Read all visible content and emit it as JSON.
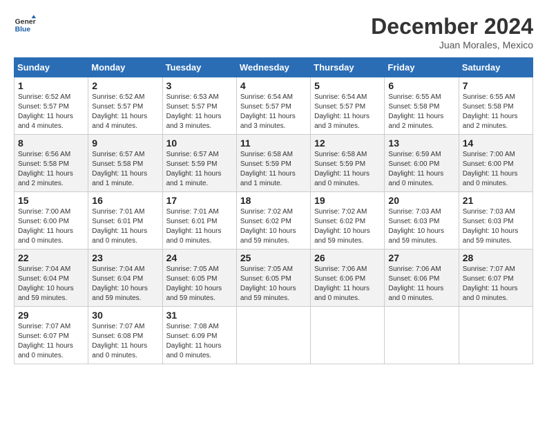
{
  "header": {
    "logo_text_general": "General",
    "logo_text_blue": "Blue",
    "main_title": "December 2024",
    "subtitle": "Juan Morales, Mexico"
  },
  "calendar": {
    "days_of_week": [
      "Sunday",
      "Monday",
      "Tuesday",
      "Wednesday",
      "Thursday",
      "Friday",
      "Saturday"
    ],
    "weeks": [
      [
        {
          "day": "1",
          "info": "Sunrise: 6:52 AM\nSunset: 5:57 PM\nDaylight: 11 hours and 4 minutes."
        },
        {
          "day": "2",
          "info": "Sunrise: 6:52 AM\nSunset: 5:57 PM\nDaylight: 11 hours and 4 minutes."
        },
        {
          "day": "3",
          "info": "Sunrise: 6:53 AM\nSunset: 5:57 PM\nDaylight: 11 hours and 3 minutes."
        },
        {
          "day": "4",
          "info": "Sunrise: 6:54 AM\nSunset: 5:57 PM\nDaylight: 11 hours and 3 minutes."
        },
        {
          "day": "5",
          "info": "Sunrise: 6:54 AM\nSunset: 5:57 PM\nDaylight: 11 hours and 3 minutes."
        },
        {
          "day": "6",
          "info": "Sunrise: 6:55 AM\nSunset: 5:58 PM\nDaylight: 11 hours and 2 minutes."
        },
        {
          "day": "7",
          "info": "Sunrise: 6:55 AM\nSunset: 5:58 PM\nDaylight: 11 hours and 2 minutes."
        }
      ],
      [
        {
          "day": "8",
          "info": "Sunrise: 6:56 AM\nSunset: 5:58 PM\nDaylight: 11 hours and 2 minutes."
        },
        {
          "day": "9",
          "info": "Sunrise: 6:57 AM\nSunset: 5:58 PM\nDaylight: 11 hours and 1 minute."
        },
        {
          "day": "10",
          "info": "Sunrise: 6:57 AM\nSunset: 5:59 PM\nDaylight: 11 hours and 1 minute."
        },
        {
          "day": "11",
          "info": "Sunrise: 6:58 AM\nSunset: 5:59 PM\nDaylight: 11 hours and 1 minute."
        },
        {
          "day": "12",
          "info": "Sunrise: 6:58 AM\nSunset: 5:59 PM\nDaylight: 11 hours and 0 minutes."
        },
        {
          "day": "13",
          "info": "Sunrise: 6:59 AM\nSunset: 6:00 PM\nDaylight: 11 hours and 0 minutes."
        },
        {
          "day": "14",
          "info": "Sunrise: 7:00 AM\nSunset: 6:00 PM\nDaylight: 11 hours and 0 minutes."
        }
      ],
      [
        {
          "day": "15",
          "info": "Sunrise: 7:00 AM\nSunset: 6:00 PM\nDaylight: 11 hours and 0 minutes."
        },
        {
          "day": "16",
          "info": "Sunrise: 7:01 AM\nSunset: 6:01 PM\nDaylight: 11 hours and 0 minutes."
        },
        {
          "day": "17",
          "info": "Sunrise: 7:01 AM\nSunset: 6:01 PM\nDaylight: 11 hours and 0 minutes."
        },
        {
          "day": "18",
          "info": "Sunrise: 7:02 AM\nSunset: 6:02 PM\nDaylight: 10 hours and 59 minutes."
        },
        {
          "day": "19",
          "info": "Sunrise: 7:02 AM\nSunset: 6:02 PM\nDaylight: 10 hours and 59 minutes."
        },
        {
          "day": "20",
          "info": "Sunrise: 7:03 AM\nSunset: 6:03 PM\nDaylight: 10 hours and 59 minutes."
        },
        {
          "day": "21",
          "info": "Sunrise: 7:03 AM\nSunset: 6:03 PM\nDaylight: 10 hours and 59 minutes."
        }
      ],
      [
        {
          "day": "22",
          "info": "Sunrise: 7:04 AM\nSunset: 6:04 PM\nDaylight: 10 hours and 59 minutes."
        },
        {
          "day": "23",
          "info": "Sunrise: 7:04 AM\nSunset: 6:04 PM\nDaylight: 10 hours and 59 minutes."
        },
        {
          "day": "24",
          "info": "Sunrise: 7:05 AM\nSunset: 6:05 PM\nDaylight: 10 hours and 59 minutes."
        },
        {
          "day": "25",
          "info": "Sunrise: 7:05 AM\nSunset: 6:05 PM\nDaylight: 10 hours and 59 minutes."
        },
        {
          "day": "26",
          "info": "Sunrise: 7:06 AM\nSunset: 6:06 PM\nDaylight: 11 hours and 0 minutes."
        },
        {
          "day": "27",
          "info": "Sunrise: 7:06 AM\nSunset: 6:06 PM\nDaylight: 11 hours and 0 minutes."
        },
        {
          "day": "28",
          "info": "Sunrise: 7:07 AM\nSunset: 6:07 PM\nDaylight: 11 hours and 0 minutes."
        }
      ],
      [
        {
          "day": "29",
          "info": "Sunrise: 7:07 AM\nSunset: 6:07 PM\nDaylight: 11 hours and 0 minutes."
        },
        {
          "day": "30",
          "info": "Sunrise: 7:07 AM\nSunset: 6:08 PM\nDaylight: 11 hours and 0 minutes."
        },
        {
          "day": "31",
          "info": "Sunrise: 7:08 AM\nSunset: 6:09 PM\nDaylight: 11 hours and 0 minutes."
        },
        {
          "day": "",
          "info": ""
        },
        {
          "day": "",
          "info": ""
        },
        {
          "day": "",
          "info": ""
        },
        {
          "day": "",
          "info": ""
        }
      ]
    ]
  }
}
